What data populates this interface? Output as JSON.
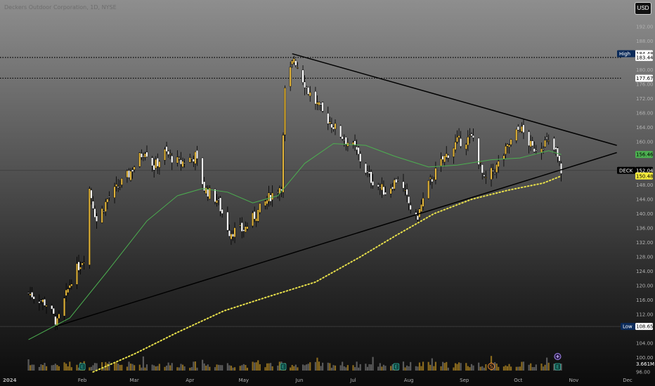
{
  "header": {
    "title": "Deckers Outdoor Corporation, 1D, NYSE"
  },
  "currency_button": {
    "label": "USD"
  },
  "colors": {
    "up": "#e0b33a",
    "down": "#ffffff",
    "ma_short": "#4caf50",
    "ma_long": "#e8e04a",
    "trendline": "#000000",
    "price_badge": "#f5ea3c",
    "ma_badge": "#4caf50"
  },
  "chart_data": {
    "type": "candlestick",
    "symbol": "DECK",
    "y_axis": {
      "min": 94,
      "max": 196,
      "ticks": [
        "96.00",
        "100.00",
        "104.00",
        "112.00",
        "116.00",
        "120.00",
        "124.00",
        "128.00",
        "132.00",
        "136.00",
        "140.00",
        "144.00",
        "148.00",
        "152.00",
        "156.00",
        "160.00",
        "164.00",
        "168.00",
        "172.00",
        "176.00",
        "180.00",
        "188.00",
        "192.00"
      ]
    },
    "x_axis": {
      "labels": [
        "2024",
        "Feb",
        "Mar",
        "Apr",
        "May",
        "Jun",
        "Jul",
        "Aug",
        "Sep",
        "Oct",
        "Nov",
        "Dec"
      ]
    },
    "price_tags": [
      {
        "label": "High",
        "value": "184.48",
        "price": 184.48
      },
      {
        "value": "183.44",
        "price": 183.44
      },
      {
        "value": "177.67",
        "price": 177.67
      },
      {
        "value": "156.46",
        "price": 156.46
      },
      {
        "label": "DECK",
        "value": "152.04",
        "price": 152.04
      },
      {
        "value": "150.48",
        "price": 150.48
      },
      {
        "label": "Low",
        "value": "108.65",
        "price": 108.65
      }
    ],
    "volume_tag": {
      "value": "3.661M"
    },
    "dotted_levels": [
      183.44,
      177.67
    ],
    "solid_levels": [
      152.04,
      108.65
    ],
    "trendlines": [
      {
        "name": "upper",
        "from": [
          "2024-05-28",
          184.48
        ],
        "to": [
          "2024-11-25",
          159.0
        ]
      },
      {
        "name": "lower",
        "from": [
          "2024-01-17",
          108.65
        ],
        "to": [
          "2024-11-25",
          157.0
        ]
      }
    ],
    "events": [
      {
        "date": "2024-02-01",
        "type": "earnings",
        "label": "E"
      },
      {
        "date": "2024-05-23",
        "type": "earnings",
        "label": "E"
      },
      {
        "date": "2024-07-25",
        "type": "earnings",
        "label": "E"
      },
      {
        "date": "2024-09-16",
        "type": "split",
        "label": "S"
      },
      {
        "date": "2024-10-23",
        "type": "earnings",
        "label": "E"
      }
    ],
    "ohlc_anchors": [
      [
        "2024-01-02",
        118
      ],
      [
        "2024-01-12",
        115
      ],
      [
        "2024-01-18",
        109.5
      ],
      [
        "2024-01-26",
        122
      ],
      [
        "2024-02-02",
        128
      ],
      [
        "2024-02-05",
        147
      ],
      [
        "2024-02-09",
        138
      ],
      [
        "2024-02-15",
        144
      ],
      [
        "2024-02-22",
        148
      ],
      [
        "2024-02-27",
        151
      ],
      [
        "2024-03-07",
        158
      ],
      [
        "2024-03-12",
        153
      ],
      [
        "2024-03-18",
        157
      ],
      [
        "2024-03-26",
        154
      ],
      [
        "2024-04-04",
        156
      ],
      [
        "2024-04-09",
        147
      ],
      [
        "2024-04-16",
        144
      ],
      [
        "2024-04-23",
        135
      ],
      [
        "2024-05-01",
        135.5
      ],
      [
        "2024-05-08",
        140
      ],
      [
        "2024-05-16",
        145
      ],
      [
        "2024-05-22",
        148
      ],
      [
        "2024-05-24",
        174
      ],
      [
        "2024-05-29",
        183.5
      ],
      [
        "2024-06-06",
        174
      ],
      [
        "2024-06-14",
        168
      ],
      [
        "2024-06-24",
        162
      ],
      [
        "2024-07-02",
        158
      ],
      [
        "2024-07-10",
        150
      ],
      [
        "2024-07-19",
        146
      ],
      [
        "2024-07-26",
        150
      ],
      [
        "2024-08-05",
        138
      ],
      [
        "2024-08-12",
        148
      ],
      [
        "2024-08-20",
        155
      ],
      [
        "2024-08-28",
        160
      ],
      [
        "2024-09-06",
        161
      ],
      [
        "2024-09-12",
        149
      ],
      [
        "2024-09-19",
        153
      ],
      [
        "2024-09-27",
        160
      ],
      [
        "2024-10-02",
        164
      ],
      [
        "2024-10-09",
        158
      ],
      [
        "2024-10-17",
        160
      ],
      [
        "2024-10-22",
        157
      ],
      [
        "2024-10-25",
        152.04
      ]
    ],
    "sma_short_anchors": [
      [
        "2024-01-02",
        105
      ],
      [
        "2024-01-25",
        111
      ],
      [
        "2024-02-15",
        124
      ],
      [
        "2024-03-08",
        138
      ],
      [
        "2024-03-25",
        145
      ],
      [
        "2024-04-08",
        147
      ],
      [
        "2024-04-22",
        146
      ],
      [
        "2024-05-06",
        143
      ],
      [
        "2024-05-20",
        145
      ],
      [
        "2024-06-04",
        154
      ],
      [
        "2024-06-20",
        159.5
      ],
      [
        "2024-07-08",
        159
      ],
      [
        "2024-07-24",
        156
      ],
      [
        "2024-08-12",
        153
      ],
      [
        "2024-08-28",
        153.5
      ],
      [
        "2024-09-16",
        155
      ],
      [
        "2024-10-02",
        155.5
      ],
      [
        "2024-10-18",
        157.5
      ],
      [
        "2024-10-25",
        156.46
      ]
    ],
    "sma_long_anchors": [
      [
        "2024-02-07",
        96
      ],
      [
        "2024-03-01",
        101
      ],
      [
        "2024-03-25",
        107
      ],
      [
        "2024-04-20",
        113
      ],
      [
        "2024-05-15",
        117
      ],
      [
        "2024-06-10",
        121
      ],
      [
        "2024-07-05",
        128
      ],
      [
        "2024-07-25",
        134
      ],
      [
        "2024-08-15",
        140
      ],
      [
        "2024-09-05",
        144
      ],
      [
        "2024-09-25",
        146.5
      ],
      [
        "2024-10-15",
        148.5
      ],
      [
        "2024-10-25",
        150.48
      ]
    ]
  }
}
